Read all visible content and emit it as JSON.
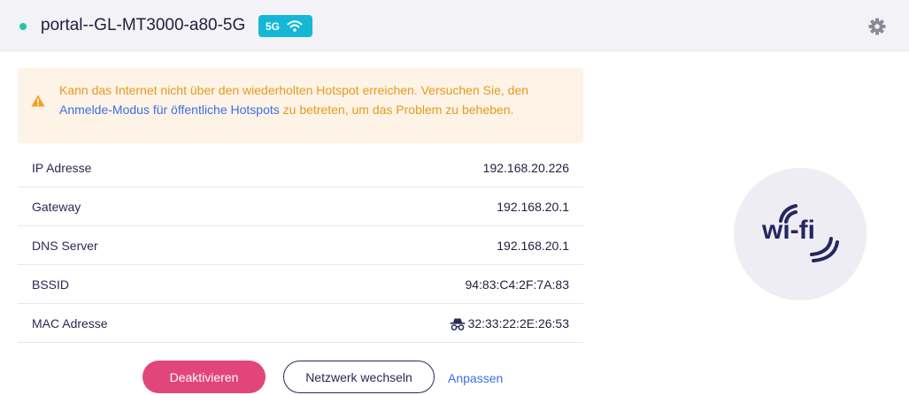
{
  "header": {
    "network_name": "portal--GL-MT3000-a80-5G",
    "band": "5G",
    "status_color": "#21c5a8",
    "badge_color": "#16b7d6",
    "icons": {
      "band": "wifi-icon",
      "settings": "gear-icon"
    }
  },
  "alert": {
    "text_before": "Kann das Internet nicht über den wiederholten Hotspot erreichen. Versuchen Sie, den ",
    "link": "Anmelde-Modus für öffentliche Hotspots",
    "text_after": " zu betreten, um das Problem zu beheben.",
    "text_color": "#e79a1e",
    "icon": "warning-icon"
  },
  "info": {
    "rows": [
      {
        "label": "IP Adresse",
        "value": "192.168.20.226"
      },
      {
        "label": "Gateway",
        "value": "192.168.20.1"
      },
      {
        "label": "DNS Server",
        "value": "192.168.20.1"
      },
      {
        "label": "BSSID",
        "value": "94:83:C4:2F:7A:83"
      },
      {
        "label": "MAC Adresse",
        "value": "32:33:22:2E:26:53",
        "icon": "incognito-icon"
      }
    ]
  },
  "actions": {
    "deactivate": "Deaktivieren",
    "switch_network": "Netzwerk wechseln",
    "adjust": "Anpassen",
    "accent_color": "#e2457a",
    "link_color": "#3a6fe8"
  },
  "illustration": {
    "label": "wi-fi",
    "icon": "wifi-logo-icon"
  }
}
